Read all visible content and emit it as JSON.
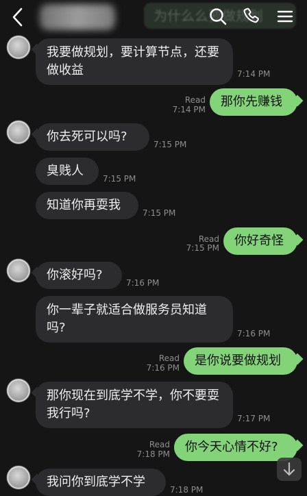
{
  "header": {
    "pinned_preview": "为什么么要做规划"
  },
  "messages": [
    {
      "side": "in",
      "text": "我要做规划，要计算节点，还要做收益",
      "time": "7:14 PM"
    },
    {
      "side": "out",
      "text": "那你先赚钱",
      "read": "Read",
      "time": "7:14 PM"
    },
    {
      "side": "in",
      "text": "你去死可以吗?",
      "time": "7:15 PM"
    },
    {
      "side": "in",
      "text": "臭贱人",
      "time": "7:15 PM"
    },
    {
      "side": "in",
      "text": "知道你再耍我",
      "time": "7:15 PM"
    },
    {
      "side": "out",
      "text": "你好奇怪",
      "read": "Read",
      "time": "7:15 PM"
    },
    {
      "side": "in",
      "text": "你滚好吗?",
      "time": "7:16 PM"
    },
    {
      "side": "in",
      "text": "你一辈子就适合做服务员知道吗?",
      "time": "7:16 PM"
    },
    {
      "side": "out",
      "text": "是你说要做规划",
      "read": "Read",
      "time": "7:16 PM"
    },
    {
      "side": "in",
      "text": "那你现在到底学不学，你不要耍我行吗?",
      "time": "7:17 PM"
    },
    {
      "side": "out",
      "text": "你今天心情不好?",
      "read": "Read",
      "time": "7:18 PM"
    },
    {
      "side": "in",
      "text": "我问你到底学不学",
      "time": "7:18 PM"
    }
  ],
  "icons": {
    "back": "chevron-left-icon",
    "search": "search-icon",
    "call": "phone-icon",
    "menu": "menu-icon",
    "scroll": "arrow-down-icon"
  },
  "colors": {
    "background": "#151515",
    "incoming_bubble": "#2c2c2e",
    "outgoing_bubble": "#83d379",
    "meta_text": "#8e8e8e"
  }
}
